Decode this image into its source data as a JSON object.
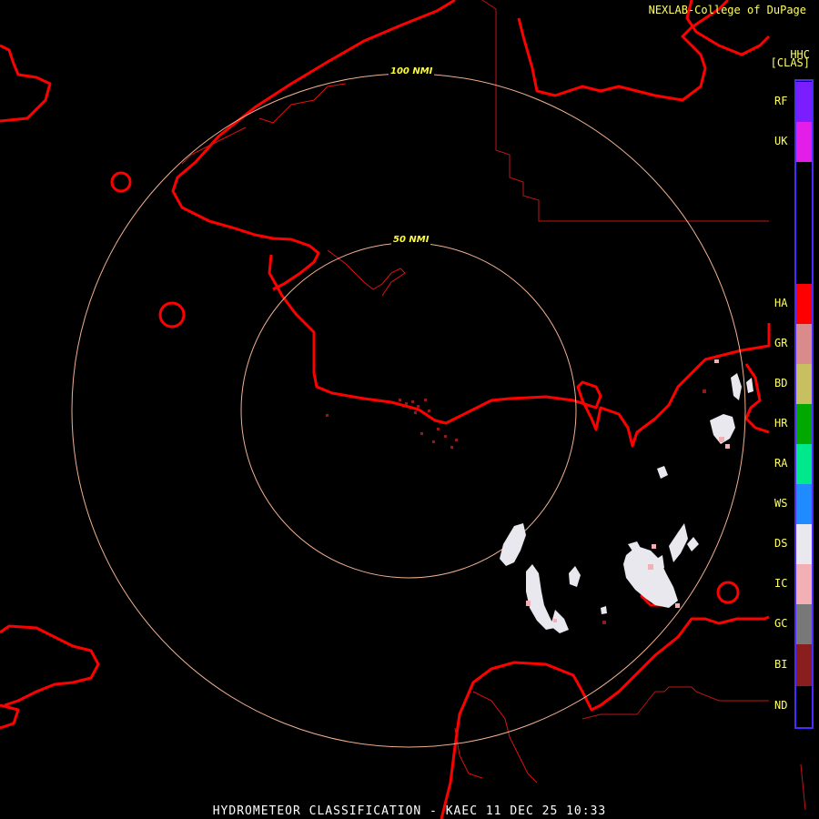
{
  "header": {
    "credit": "NEXLAB-College of DuPage",
    "product_code": "HHC",
    "product_sub": "[CLAS]"
  },
  "range_rings": [
    {
      "label": "100 NMI"
    },
    {
      "label": "50 NMI"
    }
  ],
  "legend": {
    "items": [
      {
        "code": "RF",
        "color": "#7a1eff"
      },
      {
        "code": "UK",
        "color": "#e21ee8"
      },
      {
        "code": "HA",
        "color": "#ff0000"
      },
      {
        "code": "GR",
        "color": "#d98a8a"
      },
      {
        "code": "BD",
        "color": "#c8c060"
      },
      {
        "code": "HR",
        "color": "#00a800"
      },
      {
        "code": "RA",
        "color": "#00e88c"
      },
      {
        "code": "WS",
        "color": "#1e8cff"
      },
      {
        "code": "DS",
        "color": "#e8e8ee"
      },
      {
        "code": "IC",
        "color": "#f2b0b4"
      },
      {
        "code": "GC",
        "color": "#787878"
      },
      {
        "code": "BI",
        "color": "#8a1e1e"
      },
      {
        "code": "ND",
        "color": "#000000"
      }
    ]
  },
  "footer": {
    "title": "HYDROMETEOR CLASSIFICATION - KAEC 11 DEC 25 10:33"
  },
  "colors": {
    "coastline": "#ff0000",
    "borders": "#c01414",
    "rings": "#f0b090",
    "legend_frame": "#4a2aff"
  }
}
